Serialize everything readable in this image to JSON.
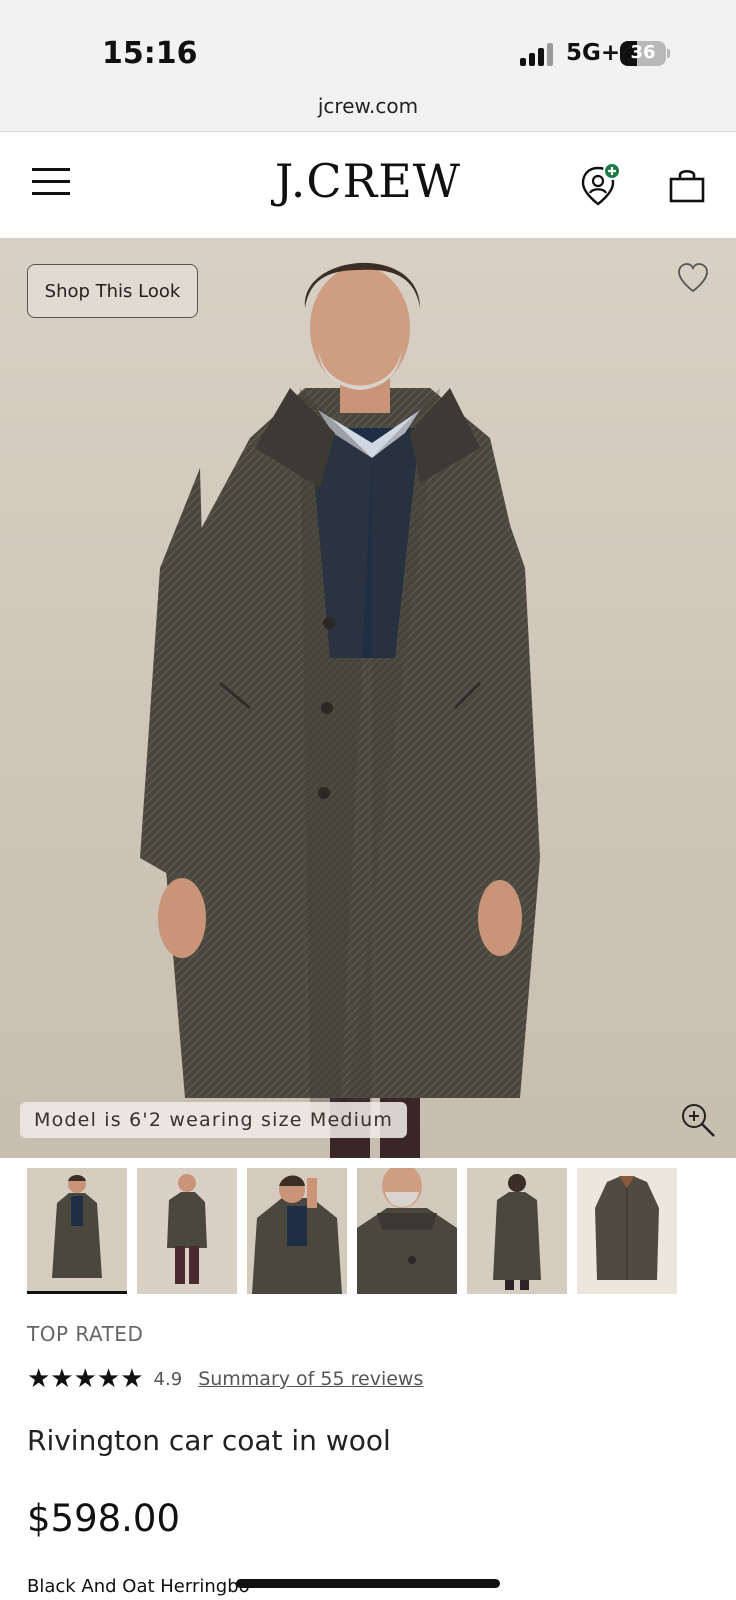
{
  "status_bar": {
    "time": "15:16",
    "network": "5G+",
    "battery_percent": "36",
    "battery_level": 0.36
  },
  "browser": {
    "url": "jcrew.com"
  },
  "header": {
    "logo": "J.CREW",
    "menu_icon": "hamburger-menu-icon",
    "account_icon": "account-plus-icon",
    "bag_icon": "shopping-bag-icon"
  },
  "hero": {
    "shop_look_label": "Shop This Look",
    "model_note": "Model is 6'2 wearing size Medium",
    "favorite_icon": "heart-icon",
    "zoom_icon": "zoom-in-icon"
  },
  "thumbnails": [
    {
      "name": "front-full",
      "active": true
    },
    {
      "name": "side-full",
      "active": false
    },
    {
      "name": "collar-up",
      "active": false
    },
    {
      "name": "collar-detail",
      "active": false
    },
    {
      "name": "back-full",
      "active": false
    },
    {
      "name": "flat-lay",
      "active": false
    }
  ],
  "product": {
    "badge": "TOP RATED",
    "stars": "★★★★★",
    "rating": "4.9",
    "reviews_link": "Summary of 55 reviews",
    "title": "Rivington car coat in wool",
    "price": "$598.00",
    "color": "Black And Oat Herringbo"
  },
  "colors": {
    "accent_green": "#1f7a4a",
    "coat": "#4a473f",
    "sweater": "#1f2e45",
    "background": "#d3cabd"
  }
}
